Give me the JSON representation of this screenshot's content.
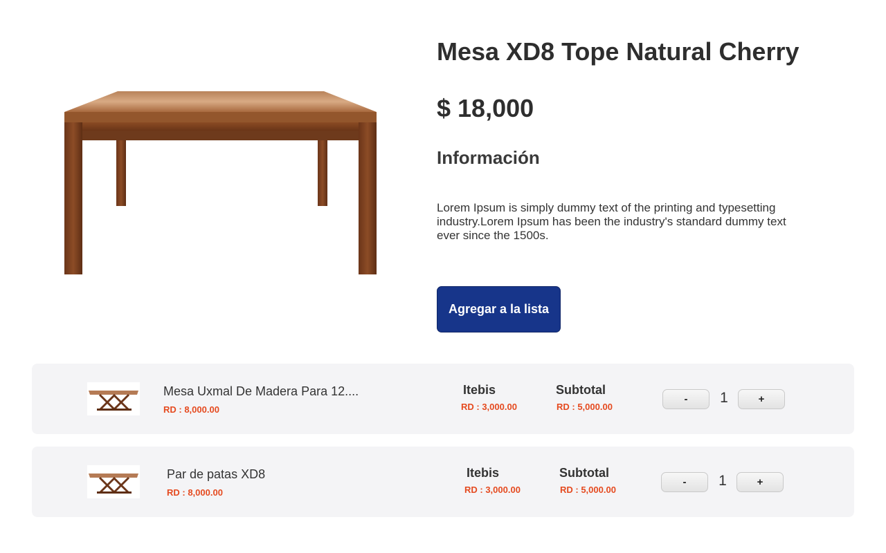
{
  "product": {
    "title": "Mesa XD8 Tope Natural Cherry",
    "price": "$ 18,000",
    "info_heading": "Información",
    "description": "Lorem Ipsum is simply dummy text of the printing and typesetting industry.Lorem Ipsum has been the industry's standard dummy text ever since the 1500s.",
    "add_button_label": "Agregar a la lista",
    "image_icon": "wooden-table-image"
  },
  "cart": {
    "items": [
      {
        "name": "Mesa Uxmal De Madera Para 12....",
        "price": "RD : 8,000.00",
        "itebis_label": "Itebis",
        "itebis_value": "RD : 3,000.00",
        "subtotal_label": "Subtotal",
        "subtotal_value": "RD : 5,000.00",
        "decrement_label": "-",
        "quantity": "1",
        "increment_label": "+"
      },
      {
        "name": "Par de patas XD8",
        "price": "RD : 8,000.00",
        "itebis_label": "Itebis",
        "itebis_value": "RD : 3,000.00",
        "subtotal_label": "Subtotal",
        "subtotal_value": "RD : 5,000.00",
        "decrement_label": "-",
        "quantity": "1",
        "increment_label": "+"
      }
    ]
  },
  "colors": {
    "accent_button": "#17358a",
    "price_red": "#e54a1f",
    "row_background": "#f4f4f6"
  }
}
